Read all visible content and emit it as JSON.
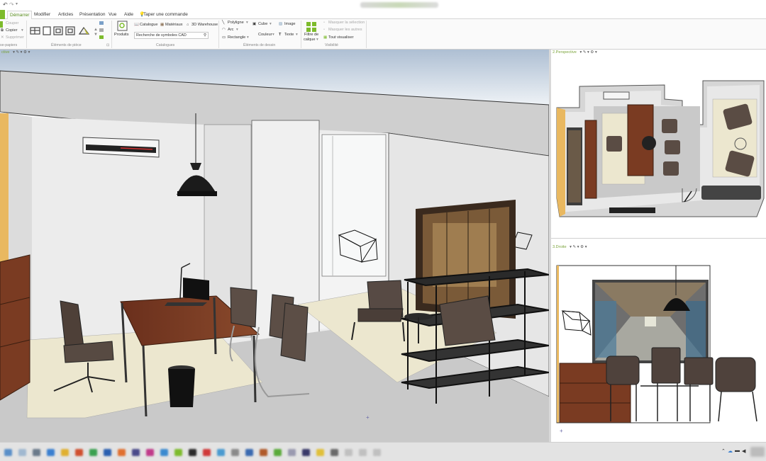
{
  "titlebar": {
    "undo_icon": "undo-icon",
    "redo_icon": "redo-icon"
  },
  "tabs": [
    {
      "label": "Démarrer",
      "active": true
    },
    {
      "label": "Modifier"
    },
    {
      "label": "Articles"
    },
    {
      "label": "Présentation"
    },
    {
      "label": "Vue"
    },
    {
      "label": "Aide"
    }
  ],
  "tell_me": "Taper une commande",
  "ribbon": {
    "clipboard": {
      "cut": "Couper",
      "copy": "Copier",
      "delete": "Supprimer",
      "paste_group": "se-papiers"
    },
    "elements_piece": "Éléments de pièce",
    "produits": "Produits",
    "catalogues": {
      "catalogue": "Catalogue",
      "materiaux": "Matériaux",
      "warehouse": "3D Warehouse",
      "search_placeholder": "Recherche de symboles CAD",
      "group": "Catalogues"
    },
    "dessin": {
      "polyligne": "Polyligne",
      "arc": "Arc",
      "rectangle": "Rectangle",
      "cube": "Cube",
      "couleur": "Couleur",
      "image": "Image",
      "texte": "Texte",
      "group": "Éléments de dessin"
    },
    "visibilite": {
      "filtre": "Filtre de",
      "calque": "calque",
      "masquer_sel": "Masquer la sélection",
      "masquer_autres": "Masquer les autres",
      "tout_visualiser": "Tout visualiser",
      "group": "Visibilité"
    }
  },
  "viewports": {
    "main": {
      "label": "ctive"
    },
    "perspective": {
      "label": "2.Perspective"
    },
    "droite": {
      "label": "3.Droite"
    }
  },
  "colors": {
    "accent": "#7dbb2c",
    "wood": "#7a3b22",
    "rug": "#ece7cf",
    "dark": "#3a3030"
  }
}
